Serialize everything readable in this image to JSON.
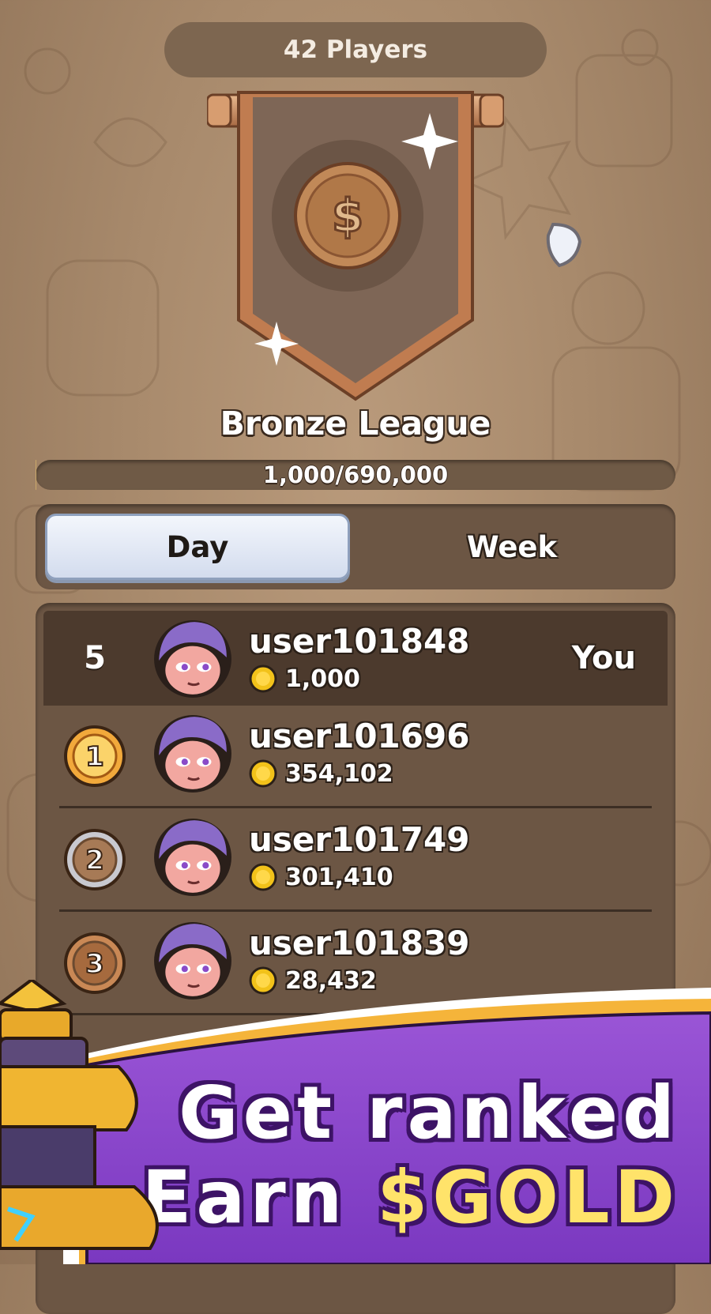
{
  "header": {
    "players_label": "42 Players"
  },
  "league": {
    "name": "Bronze League"
  },
  "progress": {
    "text": "1,000/690,000",
    "value": 1000,
    "max": 690000
  },
  "tabs": [
    {
      "label": "Day",
      "active": true
    },
    {
      "label": "Week",
      "active": false
    }
  ],
  "leaderboard": {
    "me": {
      "rank": "5",
      "username": "user101848",
      "score": "1,000",
      "tag": "You"
    },
    "rows": [
      {
        "rank": "1",
        "username": "user101696",
        "score": "354,102",
        "medal": "gold"
      },
      {
        "rank": "2",
        "username": "user101749",
        "score": "301,410",
        "medal": "silver"
      },
      {
        "rank": "3",
        "username": "user101839",
        "score": "28,432",
        "medal": "bronze"
      }
    ]
  },
  "promo": {
    "line1": "Get ranked",
    "line2_prefix": "Earn",
    "line2_highlight": "$GOLD"
  },
  "colors": {
    "accent_purple": "#8a4bc8",
    "gold_text": "#ffe36a",
    "panel_brown": "#6c5644"
  },
  "icons": [
    "league-banner-icon",
    "dollar-coin-icon",
    "sparkle-icon",
    "coin-icon",
    "avatar-icon",
    "medal-icon",
    "tower-pin-icon"
  ]
}
